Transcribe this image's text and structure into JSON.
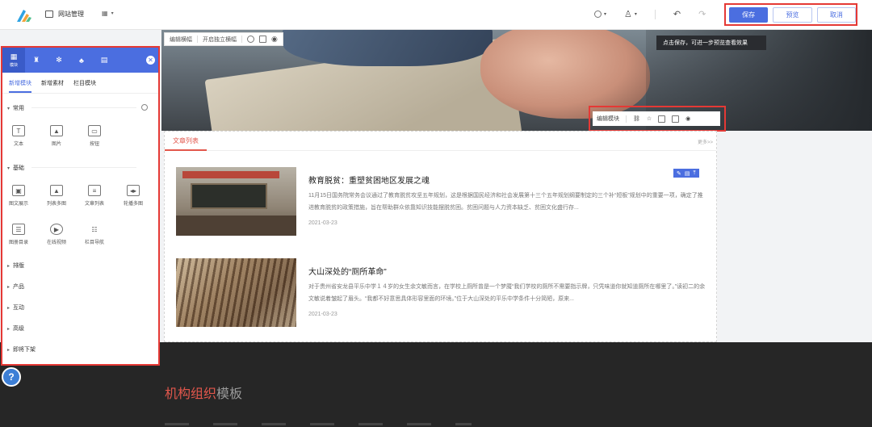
{
  "topbar": {
    "site_manage_label": "网站管理",
    "save_label": "保存",
    "preview_label": "预览",
    "cancel_label": "取消"
  },
  "edit_bar_top": {
    "edit_module": "编辑横幅",
    "independent": "开启独立横幅"
  },
  "tooltip": "点击保存，可进一步预览查看效果",
  "edit_bar_mid": {
    "edit_module": "编辑模块"
  },
  "section": {
    "tab": "文章列表",
    "more": "更多>>"
  },
  "articles": [
    {
      "title": "教育脱贫：重塑贫困地区发展之魂",
      "desc": "11月15日国务院常务会议通过了教育脱贫攻坚五年规划，这是根据国民经济和社会发展第十三个五年规划纲要制定的三个补“短板”规划中的重要一项，确定了推进教育脱贫的政策措施，旨在帮助群众依靠知识技能摆脱贫困。贫困问题与人力资本缺乏、贫困文化盛行存...",
      "date": "2021-03-23"
    },
    {
      "title": "大山深处的“厕所革命”",
      "desc": "对于贵州省安龙县平乐中学１４岁的女生余文敏而言，在学校上厕所曾是一个梦魇“我们学校的厕所不需要指示牌，只凭味道你就知道厕所在哪里了。”读初二的余文敏说着皱起了眉头。“我都不好意思具体形容里面的环境。”位于大山深处的平乐中学条件十分简陋，原来...",
      "date": "2021-03-23"
    }
  ],
  "footer": {
    "title_highlight": "机构组织",
    "title_rest": "模板"
  },
  "panel": {
    "head_tab_label": "模块",
    "sub_tabs": [
      "新增模块",
      "新增素材",
      "栏目模块"
    ],
    "sections": {
      "common": "常用",
      "basic": "基础",
      "layout": "排版",
      "product": "产品",
      "interactive": "互动",
      "advanced": "高级",
      "offline": "即将下架"
    },
    "common_items": [
      "文本",
      "图片",
      "按钮"
    ],
    "basic_items": [
      "图文展示",
      "列表多图",
      "文章列表",
      "轮播多图",
      "图册目录",
      "在线视频",
      "栏目导航"
    ]
  }
}
